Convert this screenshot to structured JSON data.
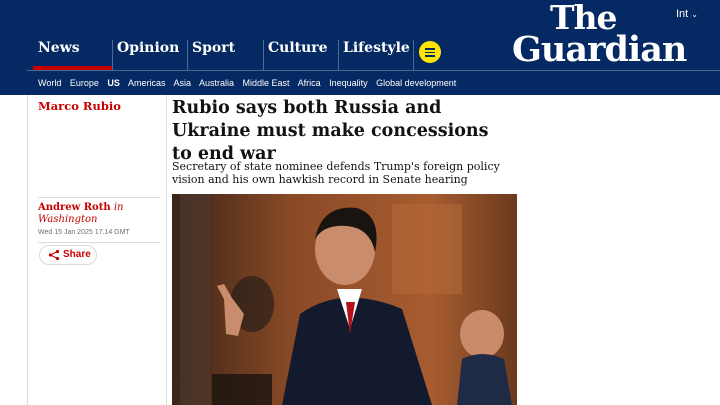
{
  "header": {
    "edition": "Int",
    "logo_line1": "The",
    "logo_line2": "Guardian",
    "pillars": [
      {
        "label": "News",
        "active": true
      },
      {
        "label": "Opinion"
      },
      {
        "label": "Sport"
      },
      {
        "label": "Culture"
      },
      {
        "label": "Lifestyle"
      }
    ],
    "subnav": [
      "World",
      "Europe",
      "US",
      "Americas",
      "Asia",
      "Australia",
      "Middle East",
      "Africa",
      "Inequality",
      "Global development"
    ],
    "subnav_active": "US"
  },
  "article": {
    "section": "Marco Rubio",
    "headline": "Rubio says both Russia and Ukraine must make concessions to end war",
    "standfirst": "Secretary of state nominee defends Trump's foreign policy vision and his own hawkish record in Senate hearing",
    "author": "Andrew Roth",
    "byline_in": "in",
    "location": "Washington",
    "date": "Wed 15 Jan 2025 17.14 GMT",
    "share_label": "Share"
  },
  "colors": {
    "brand_blue": "#052962",
    "news_red": "#c70000",
    "menu_yellow": "#ffe500"
  },
  "icons": {
    "menu": "hamburger-icon",
    "share": "share-icon"
  }
}
